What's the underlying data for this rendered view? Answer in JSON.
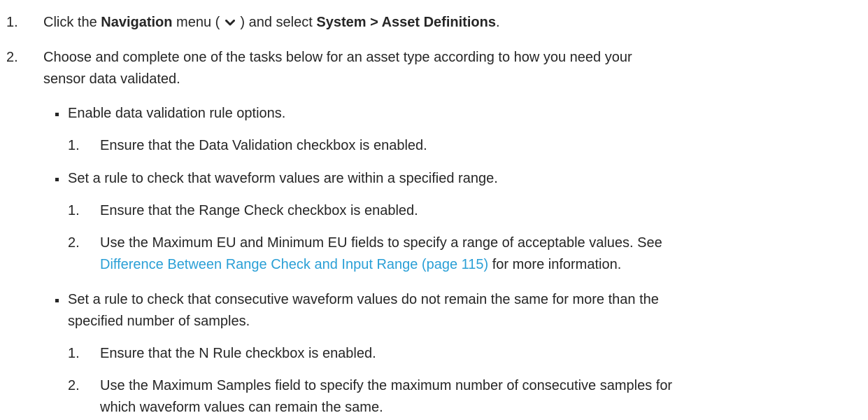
{
  "steps": {
    "s1": {
      "num": "1.",
      "p1": "Click the ",
      "nav_bold": "Navigation",
      "p2": " menu ( ",
      "p3": " ) and select ",
      "path_bold": "System > Asset Definitions",
      "p4": "."
    },
    "s2": {
      "num": "2.",
      "line1": "Choose and complete one of the tasks below for an asset type according to how you need your",
      "line2": "sensor data validated."
    }
  },
  "tasks": {
    "t1": {
      "text": "Enable data validation rule options.",
      "sub1": {
        "num": "1.",
        "text": "Ensure that the Data Validation checkbox is enabled."
      }
    },
    "t2": {
      "text": "Set a rule to check that waveform values are within a specified range.",
      "sub1": {
        "num": "1.",
        "text": "Ensure that the Range Check checkbox is enabled."
      },
      "sub2": {
        "num": "2.",
        "line1": "Use the Maximum EU and Minimum EU fields to specify a range of acceptable values. See",
        "link": "Difference Between Range Check and Input Range (page 115)",
        "after_link": " for more information."
      }
    },
    "t3": {
      "line1": "Set a rule to check that consecutive waveform values do not remain the same for more than the",
      "line2": "specified number of samples.",
      "sub1": {
        "num": "1.",
        "text": "Ensure that the N Rule checkbox is enabled."
      },
      "sub2": {
        "num": "2.",
        "line1": "Use the Maximum Samples field to specify the maximum number of consecutive samples for",
        "line2": "which waveform values can remain the same."
      }
    }
  },
  "icons": {
    "nav_menu": "chevron-down-icon"
  },
  "colors": {
    "text": "#262626",
    "link": "#2a9fd6"
  }
}
